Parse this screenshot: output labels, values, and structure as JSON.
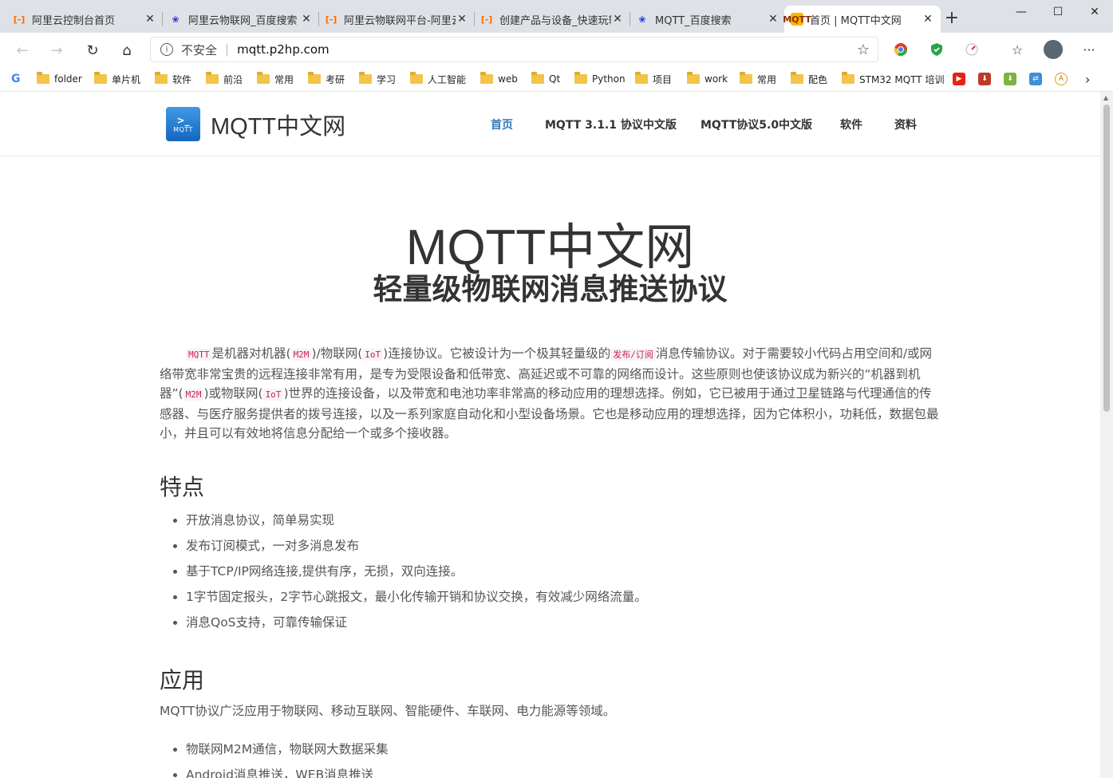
{
  "browser": {
    "tabs": [
      {
        "title": "阿里云控制台首页",
        "favicon": "aliyun-icon",
        "active": false
      },
      {
        "title": "阿里云物联网_百度搜索",
        "favicon": "baidu-icon",
        "active": false
      },
      {
        "title": "阿里云物联网平台-阿里云",
        "favicon": "aliyun-icon",
        "active": false
      },
      {
        "title": "创建产品与设备_快速玩转",
        "favicon": "aliyun-icon",
        "active": false
      },
      {
        "title": "MQTT_百度搜索",
        "favicon": "baidu-icon",
        "active": false
      },
      {
        "title": "首页 | MQTT中文网",
        "favicon": "mqtt-icon",
        "active": true
      }
    ],
    "new_tab": "+",
    "window_controls": {
      "minimize": "—",
      "maximize": "☐",
      "close": "✕"
    },
    "address": {
      "security_label": "不安全",
      "url": "mqtt.p2hp.com"
    },
    "bookmarks": [
      {
        "label": "folder",
        "type": "folder"
      },
      {
        "label": "单片机",
        "type": "folder"
      },
      {
        "label": "软件",
        "type": "folder"
      },
      {
        "label": "前沿",
        "type": "folder"
      },
      {
        "label": "常用",
        "type": "folder"
      },
      {
        "label": "考研",
        "type": "folder"
      },
      {
        "label": "学习",
        "type": "folder"
      },
      {
        "label": "人工智能",
        "type": "folder"
      },
      {
        "label": "web",
        "type": "folder"
      },
      {
        "label": "Qt",
        "type": "folder"
      },
      {
        "label": "Python",
        "type": "folder"
      },
      {
        "label": "项目",
        "type": "folder"
      },
      {
        "label": "work",
        "type": "folder"
      },
      {
        "label": "常用",
        "type": "folder"
      },
      {
        "label": "配色",
        "type": "folder"
      },
      {
        "label": "STM32 MQTT 培训",
        "type": "folder"
      }
    ]
  },
  "site": {
    "logo_text": "MQTT",
    "name": "MQTT中文网",
    "nav": [
      "首页",
      "MQTT 3.1.1 协议中文版",
      "MQTT协议5.0中文版",
      "软件",
      "资料"
    ],
    "nav_active_color": "#337ab7",
    "hero_title": "MQTT中文网",
    "hero_subtitle": "轻量级物联网消息推送协议",
    "intro": {
      "p1": "MQTT",
      "p2": "是机器对机器(",
      "p3": "M2M",
      "p4": ")/物联网(",
      "p5": "IoT",
      "p6": ")连接协议。它被设计为一个极其轻量级的",
      "p7": "发布/订阅",
      "p8": "消息传输协议。对于需要较小代码占用空间和/或网络带宽非常宝贵的远程连接非常有用，是专为受限设备和低带宽、高延迟或不可靠的网络而设计。这些原则也使该协议成为新兴的“机器到机器”(",
      "p9": "M2M",
      "p10": ")或物联网(",
      "p11": "IoT",
      "p12": ")世界的连接设备，以及带宽和电池功率非常高的移动应用的理想选择。例如，它已被用于通过卫星链路与代理通信的传感器、与医疗服务提供者的拨号连接，以及一系列家庭自动化和小型设备场景。它也是移动应用的理想选择，因为它体积小，功耗低，数据包最小，并且可以有效地将信息分配给一个或多个接收器。"
    },
    "features_heading": "特点",
    "features": [
      "开放消息协议，简单易实现",
      "发布订阅模式，一对多消息发布",
      "基于TCP/IP网络连接,提供有序，无损，双向连接。",
      "1字节固定报头，2字节心跳报文，最小化传输开销和协议交换，有效减少网络流量。",
      "消息QoS支持，可靠传输保证"
    ],
    "applications_heading": "应用",
    "applications_text": "MQTT协议广泛应用于物联网、移动互联网、智能硬件、车联网、电力能源等领域。",
    "applications": [
      "物联网M2M通信，物联网大数据采集",
      "Android消息推送，WEB消息推送"
    ]
  }
}
